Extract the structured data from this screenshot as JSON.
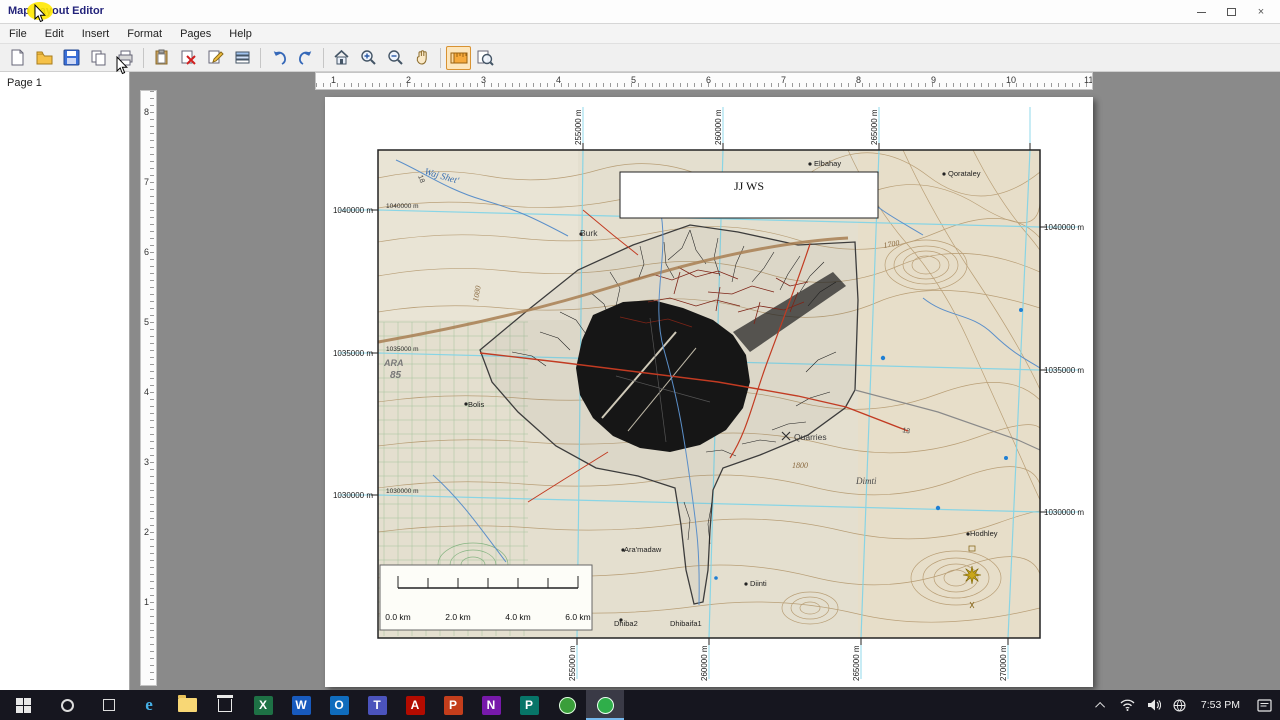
{
  "window": {
    "title": "Map Layout Editor",
    "close_glyph": "×"
  },
  "menubar": {
    "items": [
      "File",
      "Edit",
      "Insert",
      "Format",
      "Pages",
      "Help"
    ]
  },
  "toolbar": {
    "buttons": [
      "new",
      "open",
      "save",
      "duplicate",
      "print",
      "paste",
      "delete",
      "edit",
      "layers",
      "undo",
      "redo",
      "home",
      "zoom-in",
      "zoom-out",
      "pan",
      "grid-ruler",
      "zoom-page"
    ],
    "undo_glyph": "↶",
    "redo_glyph": "↷",
    "home_glyph": "⌂"
  },
  "sidebar": {
    "page_label": "Page 1"
  },
  "rulers": {
    "h": [
      "1",
      "2",
      "3",
      "4",
      "5",
      "6",
      "7",
      "8",
      "9",
      "10",
      "11"
    ],
    "v": [
      "8",
      "7",
      "6",
      "5",
      "4",
      "3",
      "2",
      "1"
    ]
  },
  "map": {
    "title": "JJ WS",
    "left_labels": [
      "1040000 m",
      "1035000 m",
      "1030000 m"
    ],
    "right_labels": [
      "1040000 m",
      "1035000 m",
      "1030000 m"
    ],
    "inner_left_labels": [
      "1040000 m",
      "1035000 m",
      "1030000 m"
    ],
    "top_labels": [
      "255000 m",
      "260000 m",
      "265000 m"
    ],
    "bottom_labels": [
      "255000 m",
      "260000 m",
      "265000 m",
      "270000 m"
    ],
    "scalebar": {
      "labels": [
        "0.0 km",
        "2.0 km",
        "4.0 km",
        "6.0 km"
      ]
    },
    "places": {
      "waj_shet": "Waj Shet'",
      "burk": "Burk",
      "elbahay": "Elbahay",
      "qorataley": "Qorataley",
      "quarries": "Quarries",
      "dimti": "Dimti",
      "hodhley": "Hodhley",
      "bolis": "Bolis",
      "aramadaw": "Ara'madaw",
      "diinti": "Diinti",
      "dhiba2": "Dhiba2",
      "dhibaifa1": "Dhibaifa1",
      "ara": "ARA",
      "r85": "85",
      "c1700": "1700",
      "c1800": "1800",
      "c1080": "1080",
      "r13": "13",
      "r18": "18"
    }
  },
  "taskbar": {
    "apps": [
      {
        "name": "edge",
        "glyph": "e"
      },
      {
        "name": "file-explorer",
        "glyph": ""
      },
      {
        "name": "store",
        "glyph": ""
      },
      {
        "name": "excel",
        "glyph": "X"
      },
      {
        "name": "word",
        "glyph": "W"
      },
      {
        "name": "outlook",
        "glyph": "O"
      },
      {
        "name": "teams",
        "glyph": "T"
      },
      {
        "name": "acrobat",
        "glyph": "A"
      },
      {
        "name": "powerpoint",
        "glyph": "P"
      },
      {
        "name": "onenote",
        "glyph": "N"
      },
      {
        "name": "publisher",
        "glyph": "P"
      },
      {
        "name": "gis-app",
        "glyph": ""
      },
      {
        "name": "map-editor",
        "glyph": ""
      }
    ],
    "tray": {
      "time": "7:53 PM"
    }
  },
  "colors": {
    "toolbar_active_bg": "#fde6bc",
    "graticule": "#7fd4e8",
    "map_paper": "#e4dfcf"
  }
}
